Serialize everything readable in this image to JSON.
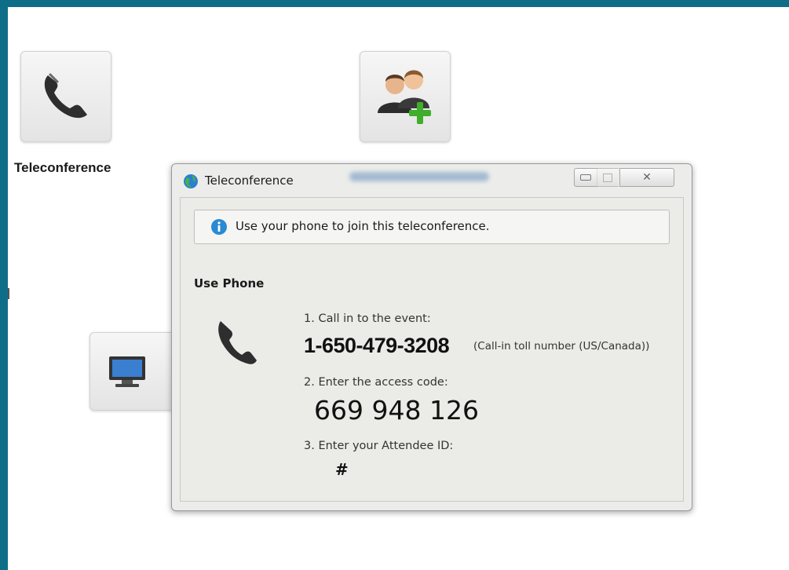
{
  "tiles": {
    "teleconference_label": "Teleconference"
  },
  "dialog": {
    "title": "Teleconference",
    "info_message": "Use your phone to join this teleconference.",
    "section_title": "Use Phone",
    "step1_label": "1. Call in to the event:",
    "phone_number": "1-650-479-3208",
    "phone_note": "(Call-in toll number (US/Canada))",
    "step2_label": "2. Enter the access code:",
    "access_code": "669 948 126",
    "step3_label": "3. Enter your Attendee ID:",
    "attendee_id_value": "#"
  },
  "icons": {
    "teleconference_tile": "phone-handset-icon",
    "add_users_tile": "add-user-group-icon",
    "computer_audio_tile": "monitor-icon",
    "dialog_app": "globe-icon",
    "info": "info-icon",
    "phone": "phone-handset-icon"
  },
  "colors": {
    "frame": "#0e6e88",
    "info_blue": "#2a8ad2",
    "add_green": "#3fae2a"
  }
}
